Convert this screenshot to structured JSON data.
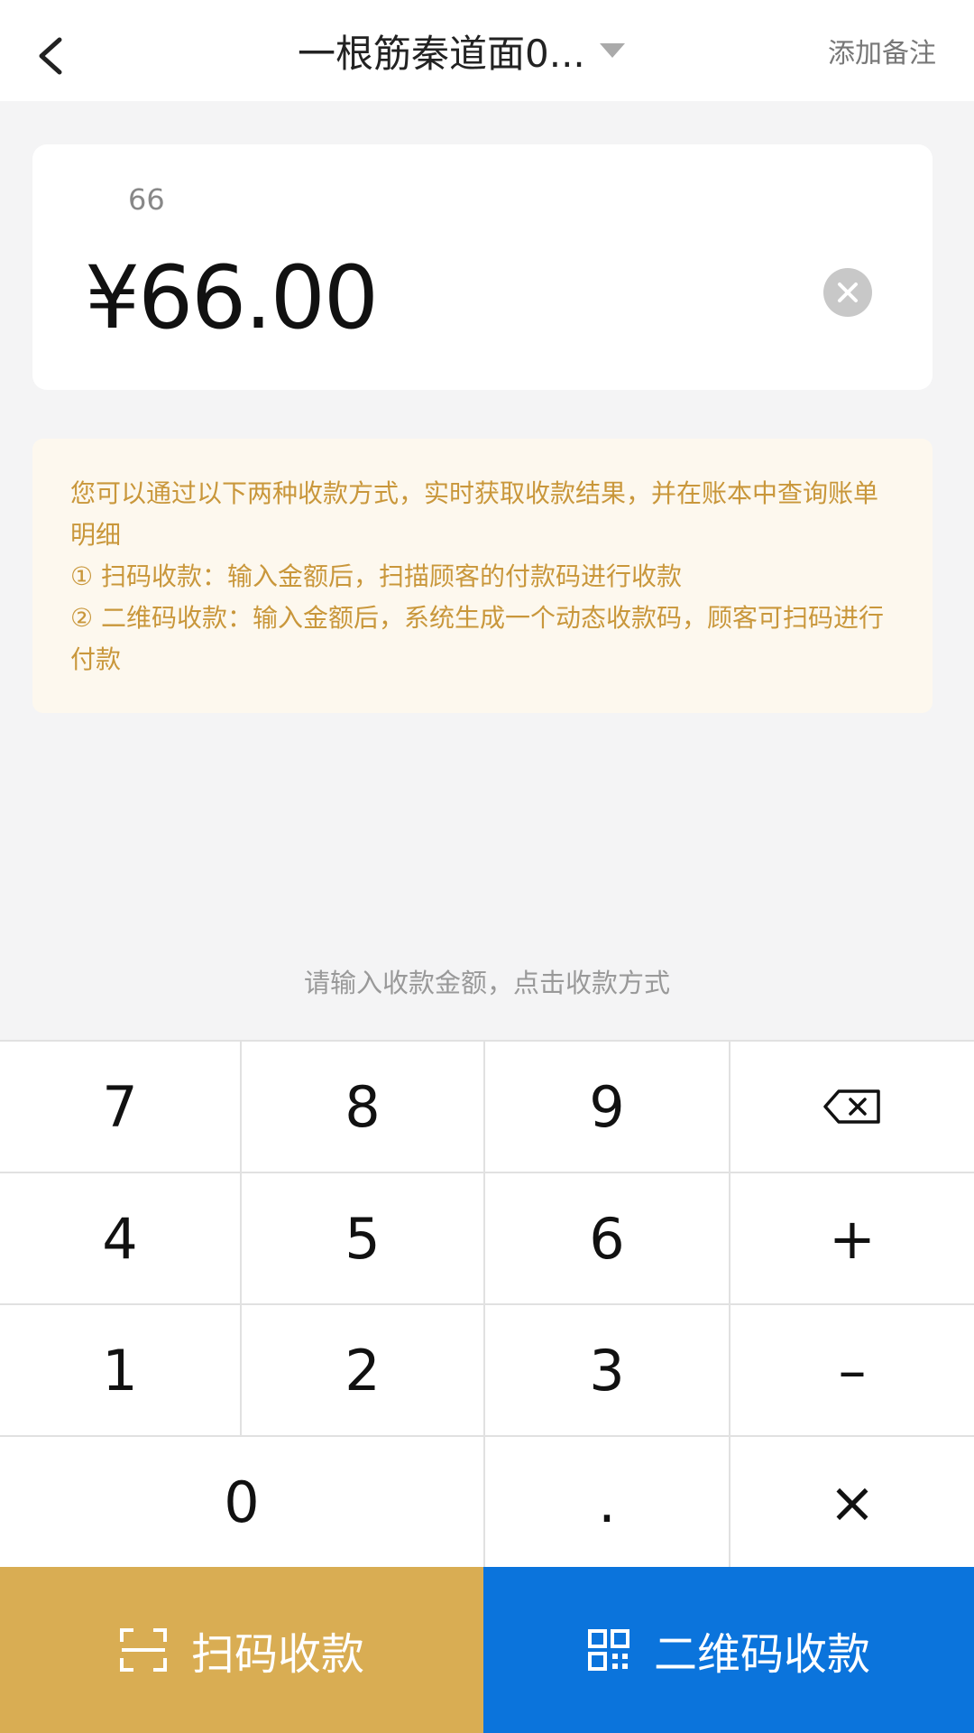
{
  "header": {
    "title": "一根筋秦道面0...",
    "remark_label": "添加备注"
  },
  "amount_card": {
    "expression": "66",
    "amount": "¥66.00"
  },
  "notice": {
    "lines": [
      "您可以通过以下两种收款方式，实时获取收款结果，并在账本中查询账单明细",
      "① 扫码收款：输入金额后，扫描顾客的付款码进行收款",
      "② 二维码收款：输入金额后，系统生成一个动态收款码，顾客可扫码进行付款"
    ]
  },
  "hint": "请输入收款金额，点击收款方式",
  "keypad": {
    "k7": "7",
    "k8": "8",
    "k9": "9",
    "k4": "4",
    "k5": "5",
    "k6": "6",
    "plus": "+",
    "k1": "1",
    "k2": "2",
    "k3": "3",
    "minus": "–",
    "k0": "0",
    "dot": ".",
    "times": "×",
    "backspace_icon": "backspace-icon"
  },
  "actions": {
    "scan_label": "扫码收款",
    "qr_label": "二维码收款",
    "scan_icon": "scan-icon",
    "qr_icon": "qr-code-icon"
  },
  "colors": {
    "scan_button": "#d9ad53",
    "qr_button": "#0b74dc",
    "notice_text": "#c9973b",
    "notice_bg": "#fdf8ee"
  }
}
